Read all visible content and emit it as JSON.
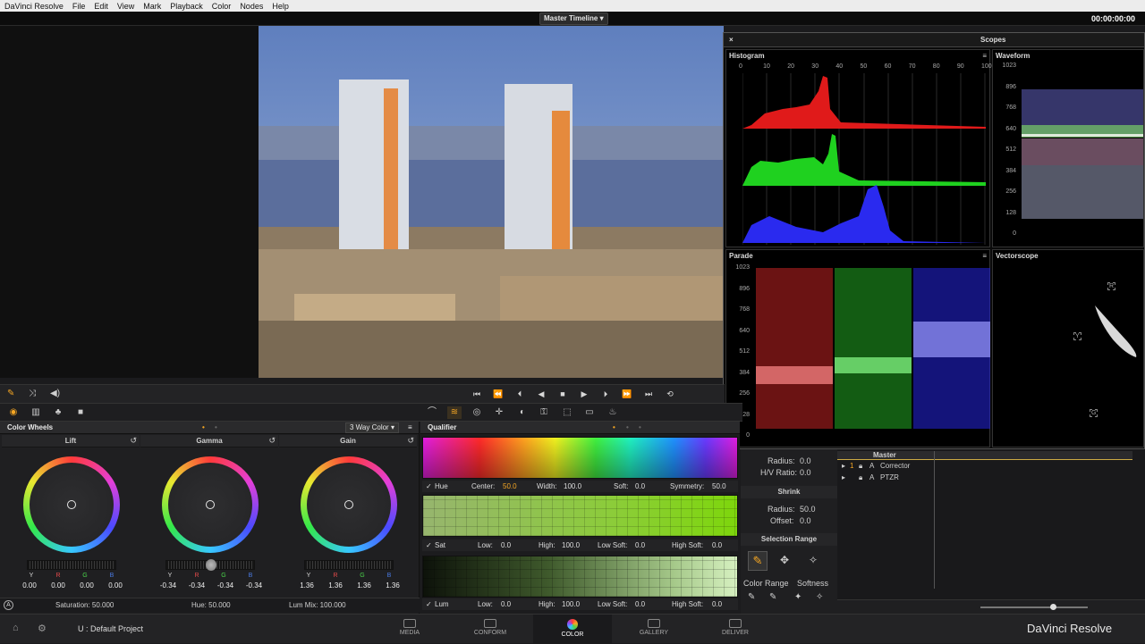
{
  "menu": [
    "DaVinci Resolve",
    "File",
    "Edit",
    "View",
    "Mark",
    "Playback",
    "Color",
    "Nodes",
    "Help"
  ],
  "timeline_dropdown": "Master Timeline",
  "timecode": "00:00:00:00",
  "colors": {
    "accent": "#f5a623",
    "bg": "#1b1b1d",
    "active": "#e8e8e8"
  },
  "scopes": {
    "title": "Scopes",
    "close": "×",
    "histogram": {
      "title": "Histogram",
      "ticks": [
        "0",
        "10",
        "20",
        "30",
        "40",
        "50",
        "60",
        "70",
        "80",
        "90",
        "100"
      ]
    },
    "waveform": {
      "title": "Waveform",
      "ticks": [
        "1023",
        "896",
        "768",
        "640",
        "512",
        "384",
        "256",
        "128",
        "0"
      ]
    },
    "parade": {
      "title": "Parade",
      "ticks": [
        "1023",
        "896",
        "768",
        "640",
        "512",
        "384",
        "256",
        "128",
        "0"
      ]
    },
    "vectorscope": {
      "title": "Vectorscope",
      "targets": [
        "R",
        "Y",
        "G"
      ]
    }
  },
  "color_wheels": {
    "title": "Color Wheels",
    "mode": "3 Way Color",
    "wheels": [
      {
        "name": "Lift",
        "labels": [
          "Y",
          "R",
          "G",
          "B"
        ],
        "values": [
          "0.00",
          "0.00",
          "0.00",
          "0.00"
        ]
      },
      {
        "name": "Gamma",
        "labels": [
          "Y",
          "R",
          "G",
          "B"
        ],
        "values": [
          "-0.34",
          "-0.34",
          "-0.34",
          "-0.34"
        ]
      },
      {
        "name": "Gain",
        "labels": [
          "Y",
          "R",
          "G",
          "B"
        ],
        "values": [
          "1.36",
          "1.36",
          "1.36",
          "1.36"
        ]
      }
    ],
    "saturation": "Saturation:  50.000",
    "hue": "Hue:  50.000",
    "lum_mix": "Lum Mix:  100.000"
  },
  "qualifier": {
    "title": "Qualifier",
    "hue": {
      "label": "Hue",
      "center_label": "Center:",
      "center": "50.0",
      "width_label": "Width:",
      "width": "100.0",
      "soft_label": "Soft:",
      "soft": "0.0",
      "sym_label": "Symmetry:",
      "sym": "50.0"
    },
    "sat": {
      "label": "Sat",
      "low_label": "Low:",
      "low": "0.0",
      "high_label": "High:",
      "high": "100.0",
      "lsoft_label": "Low Soft:",
      "lsoft": "0.0",
      "hsoft_label": "High Soft:",
      "hsoft": "0.0"
    },
    "lum": {
      "label": "Lum",
      "low_label": "Low:",
      "low": "0.0",
      "high_label": "High:",
      "high": "100.0",
      "lsoft_label": "Low Soft:",
      "lsoft": "0.0",
      "hsoft_label": "High Soft:",
      "hsoft": "0.0"
    }
  },
  "right_panel": {
    "radius_label": "Radius:",
    "radius": "0.0",
    "hv_label": "H/V Ratio:",
    "hv": "0.0",
    "shrink": "Shrink",
    "radius2_label": "Radius:",
    "radius2": "50.0",
    "offset_label": "Offset:",
    "offset": "0.0",
    "selection_range": "Selection Range",
    "color_range": "Color Range",
    "softness": "Softness"
  },
  "nodes": {
    "master": "Master",
    "items": [
      "Corrector",
      "PTZR"
    ]
  },
  "footer": {
    "project": "U : Default Project",
    "brand": "DaVinci Resolve",
    "pages": [
      "MEDIA",
      "CONFORM",
      "COLOR",
      "GALLERY",
      "DELIVER"
    ],
    "active_page": "COLOR"
  }
}
